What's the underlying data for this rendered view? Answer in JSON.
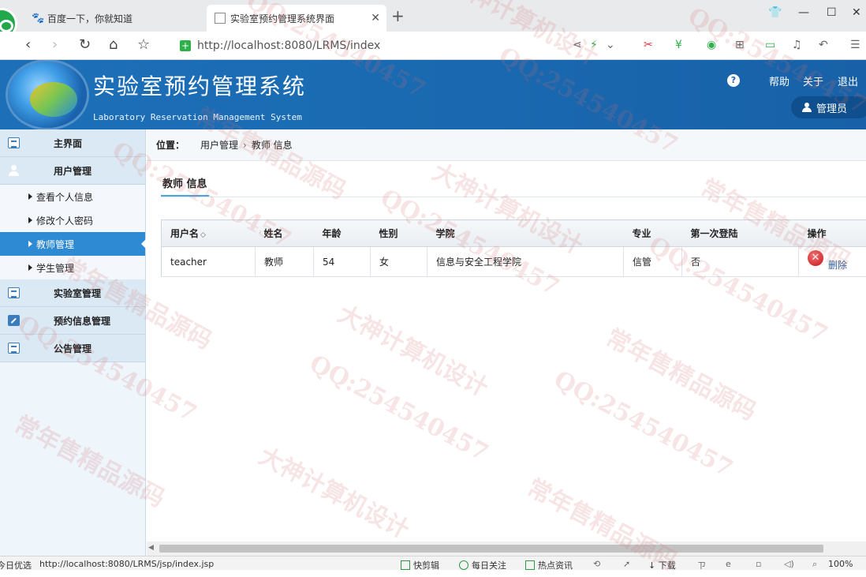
{
  "browser": {
    "tabs": [
      {
        "label": "百度一下，你就知道",
        "icon": "baidu-paw-icon"
      },
      {
        "label": "实验室预约管理系统界面",
        "icon": "page-icon"
      }
    ],
    "url": "http://localhost:8080/LRMS/index",
    "status_url": "http://localhost:8080/LRMS/jsp/index.jsp",
    "status_items": [
      "今日优选",
      "快剪辑",
      "每日关注",
      "热点资讯",
      "下载",
      "100%"
    ]
  },
  "header": {
    "title": "实验室预约管理系统",
    "subtitle": "Laboratory Reservation Management System",
    "help": "帮助",
    "about": "关于",
    "logout": "退出",
    "user": "管理员"
  },
  "sidebar": {
    "main": "主界面",
    "user_mgmt": "用户管理",
    "sub_items": [
      {
        "label": "查看个人信息"
      },
      {
        "label": "修改个人密码"
      },
      {
        "label": "教师管理"
      },
      {
        "label": "学生管理"
      }
    ],
    "lab_mgmt": "实验室管理",
    "reservation_mgmt": "预约信息管理",
    "notice_mgmt": "公告管理"
  },
  "breadcrumb": {
    "label": "位置：",
    "items": [
      "用户管理",
      "教师 信息"
    ]
  },
  "section_title": "教师 信息",
  "table": {
    "headers": [
      "用户名",
      "姓名",
      "年龄",
      "性别",
      "学院",
      "专业",
      "第一次登陆",
      "操作"
    ],
    "rows": [
      {
        "username": "teacher",
        "name": "教师",
        "age": "54",
        "gender": "女",
        "college": "信息与安全工程学院",
        "major": "信管",
        "first_login": "否",
        "action": "删除"
      }
    ]
  },
  "watermarks": [
    "QQ:254540457",
    "大神计算机设计",
    "常年售精品源码"
  ]
}
